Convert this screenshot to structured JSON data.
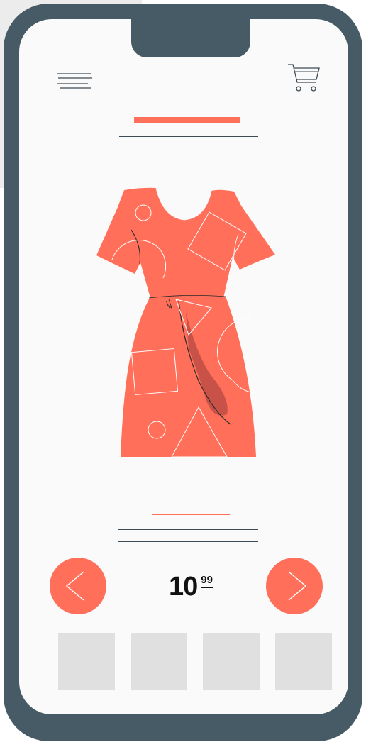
{
  "colors": {
    "accent": "#ff6f5a",
    "phone_frame": "#465b66",
    "screen": "#fafafa",
    "line": "#3d4b54",
    "thumbnail": "#e0e0e0",
    "dress_shadow": "#c85247"
  },
  "header": {
    "menu_icon": "hamburger-menu-icon",
    "cart_icon": "shopping-cart-icon"
  },
  "product": {
    "image": "red-dress-with-geometric-pattern"
  },
  "price": {
    "whole": "10",
    "cents": "99"
  },
  "navigation": {
    "prev_icon": "chevron-left-icon",
    "next_icon": "chevron-right-icon"
  },
  "thumbnails": [
    {
      "id": "thumb-1"
    },
    {
      "id": "thumb-2"
    },
    {
      "id": "thumb-3"
    },
    {
      "id": "thumb-4"
    }
  ]
}
